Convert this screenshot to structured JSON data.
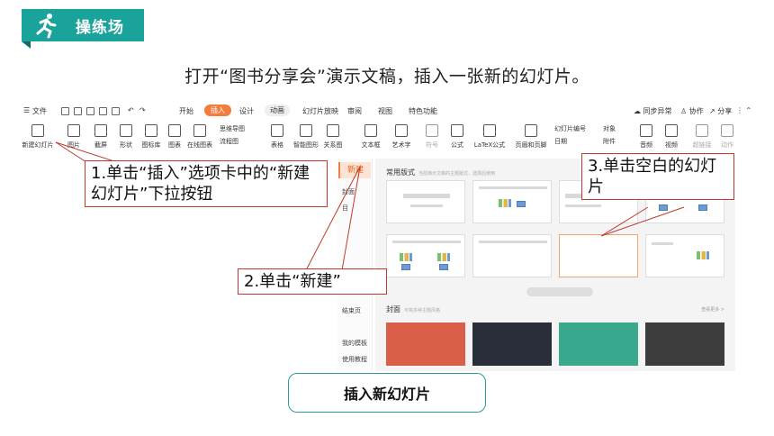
{
  "header": {
    "tag_text": "操练场",
    "icon": "running-person-icon",
    "accent_color": "#1aa39a"
  },
  "instruction": "打开“图书分享会”演示文稿，插入一张新的幻灯片。",
  "menubar": {
    "file_label": "文件",
    "tabs": [
      "开始",
      "插入",
      "设计",
      "动画",
      "幻灯片放映",
      "审阅",
      "视图",
      "特色功能"
    ],
    "active_tab": "插入",
    "right": [
      "同步异常",
      "协作",
      "分享"
    ]
  },
  "ribbon": {
    "items": [
      "新建幻灯片",
      "图片",
      "截屏",
      "形状",
      "图标库",
      "图表",
      "在线图表",
      "表格",
      "智能图形",
      "关系图",
      "文本框",
      "艺术字",
      "符号",
      "公式",
      "LaTeX公式",
      "页眉和页脚",
      "音频",
      "视频",
      "超链接",
      "动作"
    ],
    "mini": [
      "思维导图",
      "流程图",
      "幻灯片编号",
      "日期",
      "对象",
      "附件"
    ]
  },
  "leftpane": {
    "new_label": "新建",
    "items": [
      "封面",
      "目",
      "结束页",
      "我的模板",
      "使用教程"
    ]
  },
  "main": {
    "section_common": "常用版式",
    "section_common_sub": "当前演示文稿的主题版式，选择后使用",
    "section_cover": "封面",
    "section_cover_sub": "可将多种主题风格",
    "more": "查看更多 >"
  },
  "covers": [
    "#d95f4b",
    "#2a2d3a",
    "#3aa88c",
    "#3d3d3d"
  ],
  "callouts": {
    "step1": "1.单击“插入”选项卡中的“新建幻灯片”下拉按钮",
    "step2": "2.单击“新建”",
    "step3": "3.单击空白的幻灯片"
  },
  "bottom_label": "插入新幻灯片"
}
